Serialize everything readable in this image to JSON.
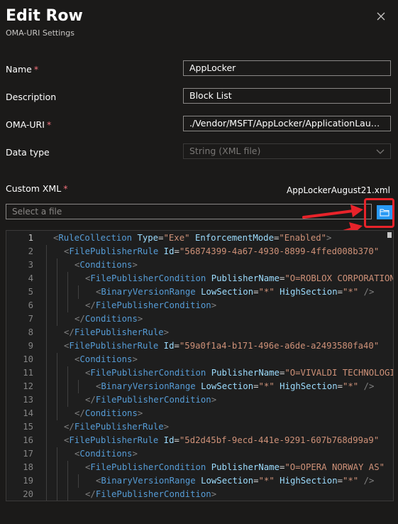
{
  "panel": {
    "title": "Edit Row",
    "subtitle": "OMA-URI Settings",
    "required_marker": "*"
  },
  "form": {
    "name_label": "Name",
    "name_value": "AppLocker",
    "description_label": "Description",
    "description_value": "Block List",
    "omauri_label": "OMA-URI",
    "omauri_value": "./Vendor/MSFT/AppLocker/ApplicationLaunch...",
    "datatype_label": "Data type",
    "datatype_value": "String (XML file)",
    "customxml_label": "Custom XML",
    "file_name": "AppLockerAugust21.xml",
    "file_placeholder": "Select a file"
  },
  "editor": {
    "lines": [
      {
        "n": "1",
        "indent": 0,
        "parts": [
          [
            "t",
            "<"
          ],
          [
            "tg",
            "RuleCollection"
          ],
          [
            "eq",
            " "
          ],
          [
            "at",
            "Type"
          ],
          [
            "eq",
            "="
          ],
          [
            "vl",
            "\"Exe\""
          ],
          [
            "eq",
            " "
          ],
          [
            "at",
            "EnforcementMode"
          ],
          [
            "eq",
            "="
          ],
          [
            "vl",
            "\"Enabled\""
          ],
          [
            "t",
            ">"
          ]
        ]
      },
      {
        "n": "2",
        "indent": 1,
        "parts": [
          [
            "t",
            "<"
          ],
          [
            "tg",
            "FilePublisherRule"
          ],
          [
            "eq",
            " "
          ],
          [
            "at",
            "Id"
          ],
          [
            "eq",
            "="
          ],
          [
            "vl",
            "\"56874399-4a67-4930-8899-4ffed008b370\""
          ]
        ]
      },
      {
        "n": "3",
        "indent": 2,
        "parts": [
          [
            "t",
            "<"
          ],
          [
            "tg",
            "Conditions"
          ],
          [
            "t",
            ">"
          ]
        ]
      },
      {
        "n": "4",
        "indent": 3,
        "parts": [
          [
            "t",
            "<"
          ],
          [
            "tg",
            "FilePublisherCondition"
          ],
          [
            "eq",
            " "
          ],
          [
            "at",
            "PublisherName"
          ],
          [
            "eq",
            "="
          ],
          [
            "vl",
            "\"O=ROBLOX CORPORATION\""
          ]
        ]
      },
      {
        "n": "5",
        "indent": 4,
        "parts": [
          [
            "t",
            "<"
          ],
          [
            "tg",
            "BinaryVersionRange"
          ],
          [
            "eq",
            " "
          ],
          [
            "at",
            "LowSection"
          ],
          [
            "eq",
            "="
          ],
          [
            "vl",
            "\"*\""
          ],
          [
            "eq",
            " "
          ],
          [
            "at",
            "HighSection"
          ],
          [
            "eq",
            "="
          ],
          [
            "vl",
            "\"*\""
          ],
          [
            "eq",
            " "
          ],
          [
            "t",
            "/>"
          ]
        ]
      },
      {
        "n": "6",
        "indent": 3,
        "parts": [
          [
            "t",
            "</"
          ],
          [
            "tg",
            "FilePublisherCondition"
          ],
          [
            "t",
            ">"
          ]
        ]
      },
      {
        "n": "7",
        "indent": 2,
        "parts": [
          [
            "t",
            "</"
          ],
          [
            "tg",
            "Conditions"
          ],
          [
            "t",
            ">"
          ]
        ]
      },
      {
        "n": "8",
        "indent": 1,
        "parts": [
          [
            "t",
            "</"
          ],
          [
            "tg",
            "FilePublisherRule"
          ],
          [
            "t",
            ">"
          ]
        ]
      },
      {
        "n": "9",
        "indent": 1,
        "parts": [
          [
            "t",
            "<"
          ],
          [
            "tg",
            "FilePublisherRule"
          ],
          [
            "eq",
            " "
          ],
          [
            "at",
            "Id"
          ],
          [
            "eq",
            "="
          ],
          [
            "vl",
            "\"59a0f1a4-b171-496e-a6de-a2493580fa40\""
          ]
        ]
      },
      {
        "n": "10",
        "indent": 2,
        "parts": [
          [
            "t",
            "<"
          ],
          [
            "tg",
            "Conditions"
          ],
          [
            "t",
            ">"
          ]
        ]
      },
      {
        "n": "11",
        "indent": 3,
        "parts": [
          [
            "t",
            "<"
          ],
          [
            "tg",
            "FilePublisherCondition"
          ],
          [
            "eq",
            " "
          ],
          [
            "at",
            "PublisherName"
          ],
          [
            "eq",
            "="
          ],
          [
            "vl",
            "\"O=VIVALDI TECHNOLOGIES\""
          ]
        ]
      },
      {
        "n": "12",
        "indent": 4,
        "parts": [
          [
            "t",
            "<"
          ],
          [
            "tg",
            "BinaryVersionRange"
          ],
          [
            "eq",
            " "
          ],
          [
            "at",
            "LowSection"
          ],
          [
            "eq",
            "="
          ],
          [
            "vl",
            "\"*\""
          ],
          [
            "eq",
            " "
          ],
          [
            "at",
            "HighSection"
          ],
          [
            "eq",
            "="
          ],
          [
            "vl",
            "\"*\""
          ],
          [
            "eq",
            " "
          ],
          [
            "t",
            "/>"
          ]
        ]
      },
      {
        "n": "13",
        "indent": 3,
        "parts": [
          [
            "t",
            "</"
          ],
          [
            "tg",
            "FilePublisherCondition"
          ],
          [
            "t",
            ">"
          ]
        ]
      },
      {
        "n": "14",
        "indent": 2,
        "parts": [
          [
            "t",
            "</"
          ],
          [
            "tg",
            "Conditions"
          ],
          [
            "t",
            ">"
          ]
        ]
      },
      {
        "n": "15",
        "indent": 1,
        "parts": [
          [
            "t",
            "</"
          ],
          [
            "tg",
            "FilePublisherRule"
          ],
          [
            "t",
            ">"
          ]
        ]
      },
      {
        "n": "16",
        "indent": 1,
        "parts": [
          [
            "t",
            "<"
          ],
          [
            "tg",
            "FilePublisherRule"
          ],
          [
            "eq",
            " "
          ],
          [
            "at",
            "Id"
          ],
          [
            "eq",
            "="
          ],
          [
            "vl",
            "\"5d2d45bf-9ecd-441e-9291-607b768d99a9\""
          ]
        ]
      },
      {
        "n": "17",
        "indent": 2,
        "parts": [
          [
            "t",
            "<"
          ],
          [
            "tg",
            "Conditions"
          ],
          [
            "t",
            ">"
          ]
        ]
      },
      {
        "n": "18",
        "indent": 3,
        "parts": [
          [
            "t",
            "<"
          ],
          [
            "tg",
            "FilePublisherCondition"
          ],
          [
            "eq",
            " "
          ],
          [
            "at",
            "PublisherName"
          ],
          [
            "eq",
            "="
          ],
          [
            "vl",
            "\"O=OPERA NORWAY AS\""
          ]
        ]
      },
      {
        "n": "19",
        "indent": 4,
        "parts": [
          [
            "t",
            "<"
          ],
          [
            "tg",
            "BinaryVersionRange"
          ],
          [
            "eq",
            " "
          ],
          [
            "at",
            "LowSection"
          ],
          [
            "eq",
            "="
          ],
          [
            "vl",
            "\"*\""
          ],
          [
            "eq",
            " "
          ],
          [
            "at",
            "HighSection"
          ],
          [
            "eq",
            "="
          ],
          [
            "vl",
            "\"*\""
          ],
          [
            "eq",
            " "
          ],
          [
            "t",
            "/>"
          ]
        ]
      },
      {
        "n": "20",
        "indent": 3,
        "parts": [
          [
            "t",
            "</"
          ],
          [
            "tg",
            "FilePublisherCondition"
          ],
          [
            "t",
            ">"
          ]
        ]
      }
    ]
  },
  "icons": {
    "close": "close-icon",
    "dropdown": "chevron-down-icon",
    "browse": "folder-icon"
  },
  "colors": {
    "background": "#1b1a19",
    "accent": "#2899f5",
    "required": "#f1707b",
    "annotation": "#e8232a"
  }
}
